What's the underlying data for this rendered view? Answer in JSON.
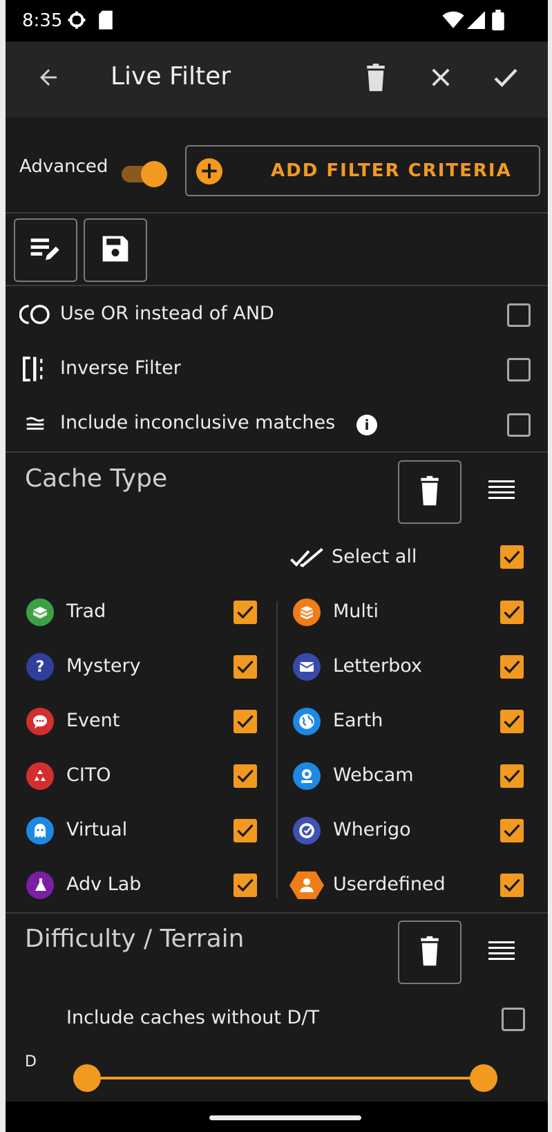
{
  "status": {
    "time": "8:35"
  },
  "appbar": {
    "title": "Live Filter"
  },
  "advanced": {
    "label": "Advanced"
  },
  "add_filter": {
    "label": "ADD FILTER CRITERIA"
  },
  "options": [
    {
      "label": "Use OR instead of AND",
      "checked": false
    },
    {
      "label": "Inverse Filter",
      "checked": false
    },
    {
      "label": "Include inconclusive matches",
      "checked": false
    }
  ],
  "cache_type": {
    "title": "Cache Type",
    "select_all": "Select all",
    "left": [
      {
        "label": "Trad",
        "color": "#3da144"
      },
      {
        "label": "Mystery",
        "color": "#2f3f9c"
      },
      {
        "label": "Event",
        "color": "#d32f2f"
      },
      {
        "label": "CITO",
        "color": "#d32f2f"
      },
      {
        "label": "Virtual",
        "color": "#1e88e5"
      },
      {
        "label": "Adv Lab",
        "color": "#7b1fa2"
      }
    ],
    "right": [
      {
        "label": "Multi",
        "color": "#ef7d1a"
      },
      {
        "label": "Letterbox",
        "color": "#3949ab"
      },
      {
        "label": "Earth",
        "color": "#1e88e5"
      },
      {
        "label": "Webcam",
        "color": "#1e88e5"
      },
      {
        "label": "Wherigo",
        "color": "#3f51b5"
      },
      {
        "label": "Userdefined",
        "color": "#ef7d1a"
      }
    ]
  },
  "difficulty": {
    "title": "Difficulty / Terrain",
    "include_label": "Include caches without D/T",
    "d_label": "D"
  },
  "colors": {
    "accent": "#f29a1f",
    "background": "#1b1b1b",
    "appbar": "#252525"
  }
}
